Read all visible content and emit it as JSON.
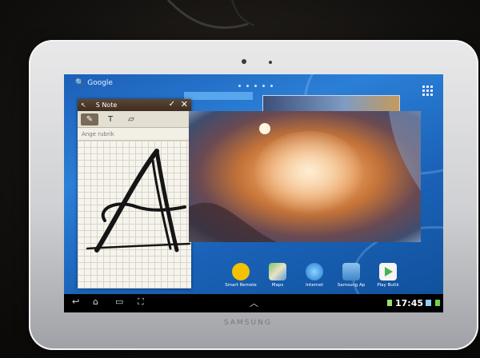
{
  "search": {
    "label": "Google"
  },
  "snote": {
    "title": "S Note",
    "confirm_glyph": "✓",
    "close_glyph": "✕",
    "back_glyph": "↖",
    "tools": {
      "pen": "✎",
      "text": "T",
      "eraser": "▱"
    },
    "title_placeholder": "Ange rubrik"
  },
  "dock": [
    {
      "label": "Smart Remote",
      "color": "#f2c200"
    },
    {
      "label": "Maps",
      "color": "#5fb24e"
    },
    {
      "label": "Internet",
      "color": "#2b8fe0"
    },
    {
      "label": "Samsung Ap",
      "color": "#5aa1d8"
    },
    {
      "label": "Play Butik",
      "color": "#f0f0f0"
    }
  ],
  "status": {
    "time": "17:45"
  },
  "nav": {
    "back": "↩",
    "home": "⌂",
    "recent": "▭",
    "screenshot": "⛶",
    "up": "︿"
  },
  "device": {
    "brand": "SAMSUNG"
  },
  "colors": {
    "wallpaper": "#1f6fc8",
    "snote_bar": "#4a3728",
    "navbar": "#000000"
  }
}
